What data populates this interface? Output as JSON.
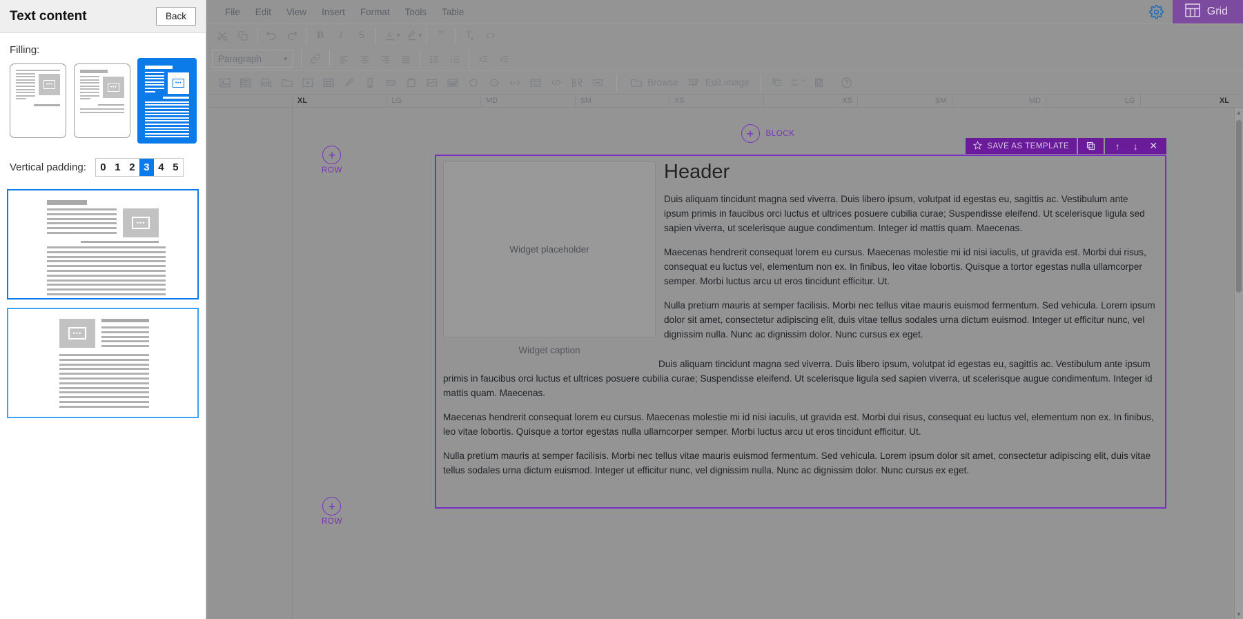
{
  "panel": {
    "title": "Text content",
    "back_label": "Back",
    "filling_label": "Filling:",
    "filling_options": [
      {
        "name": "layout-text-left-image-right",
        "selected": false
      },
      {
        "name": "layout-heading-text-image",
        "selected": false
      },
      {
        "name": "layout-dense-text-image",
        "selected": true
      }
    ],
    "vertical_padding_label": "Vertical padding:",
    "vertical_padding_options": [
      "0",
      "1",
      "2",
      "3",
      "4",
      "5"
    ],
    "vertical_padding_selected": "3",
    "preview_thumbnails": [
      {
        "name": "preview-variant-1",
        "selected": true
      },
      {
        "name": "preview-variant-2",
        "selected": true
      }
    ]
  },
  "menubar": {
    "items": [
      "File",
      "Edit",
      "View",
      "Insert",
      "Format",
      "Tools",
      "Table"
    ],
    "gear_icon": "gear-icon",
    "grid_label": "Grid",
    "grid_icon": "grid-icon"
  },
  "toolbar_row1": [
    {
      "icon": "cut-icon"
    },
    {
      "icon": "copy-icon"
    },
    {
      "sep": true
    },
    {
      "icon": "undo-icon"
    },
    {
      "icon": "redo-icon"
    },
    {
      "sep": true
    },
    {
      "icon": "bold-icon",
      "text": "B"
    },
    {
      "icon": "italic-icon",
      "text": "I"
    },
    {
      "icon": "strikethrough-icon",
      "text": "S"
    },
    {
      "sep": true
    },
    {
      "icon": "text-color-icon",
      "text": "A"
    },
    {
      "icon": "chevron-down-icon"
    },
    {
      "icon": "highlight-color-icon"
    },
    {
      "icon": "chevron-down-icon"
    },
    {
      "sep": true
    },
    {
      "icon": "blockquote-icon"
    },
    {
      "sep": true
    },
    {
      "icon": "clear-formatting-icon"
    },
    {
      "icon": "source-code-icon"
    }
  ],
  "toolbar_row2": {
    "format_select_value": "Paragraph",
    "items": [
      {
        "icon": "link-icon"
      },
      {
        "sep": true
      },
      {
        "icon": "align-left-icon"
      },
      {
        "icon": "align-center-icon"
      },
      {
        "icon": "align-right-icon"
      },
      {
        "icon": "align-justify-icon"
      },
      {
        "sep": true
      },
      {
        "icon": "bullet-list-icon"
      },
      {
        "icon": "numbered-list-icon"
      },
      {
        "sep": true
      },
      {
        "icon": "outdent-icon"
      },
      {
        "icon": "indent-icon"
      }
    ]
  },
  "toolbar_row3": {
    "items": [
      {
        "icon": "image-icon"
      },
      {
        "icon": "image-gallery-icon"
      },
      {
        "icon": "image-stack-icon"
      },
      {
        "icon": "folder-icon"
      },
      {
        "icon": "video-icon"
      },
      {
        "icon": "table-icon"
      },
      {
        "icon": "color-picker-icon"
      },
      {
        "icon": "mobile-icon"
      },
      {
        "icon": "button-icon"
      },
      {
        "icon": "clipboard-icon"
      },
      {
        "icon": "chart-icon"
      },
      {
        "icon": "layout-icon"
      },
      {
        "icon": "circle-icon"
      },
      {
        "icon": "number-circle-icon"
      },
      {
        "icon": "html-tag-icon"
      },
      {
        "icon": "embed-icon"
      },
      {
        "icon": "code-icon"
      },
      {
        "icon": "qr-code-icon"
      },
      {
        "icon": "more-icon"
      }
    ],
    "browse_label": "Browse",
    "browse_icon": "folder-open-icon",
    "edit_image_label": "Edit image",
    "edit_image_icon": "edit-image-icon",
    "extra_icons": [
      {
        "icon": "duplicate-icon"
      },
      {
        "icon": "env-mode-icon"
      },
      {
        "icon": "calculator-icon"
      },
      {
        "icon": "help-icon"
      }
    ]
  },
  "ruler": {
    "left_segments": [
      "XL",
      "LG",
      "MD",
      "SM",
      "XS"
    ],
    "right_segments": [
      "XS",
      "SM",
      "MD",
      "LG",
      "XL"
    ],
    "active": "XL"
  },
  "canvas": {
    "block_add_label": "BLOCK",
    "row_add_label": "ROW",
    "plus_symbol": "+",
    "row_toolbar": {
      "save_as_template_label": "SAVE AS TEMPLATE",
      "star_icon": "star-icon",
      "duplicate_icon": "duplicate-icon",
      "move_up_icon": "arrow-up-icon",
      "move_down_icon": "arrow-down-icon",
      "close_icon": "close-icon"
    },
    "widget_placeholder": "Widget placeholder",
    "widget_caption": "Widget caption",
    "heading": "Header",
    "paragraphs": [
      "Duis aliquam tincidunt magna sed viverra. Duis libero ipsum, volutpat id egestas eu, sagittis ac. Vestibulum ante ipsum primis in faucibus orci luctus et ultrices posuere cubilia curae; Suspendisse eleifend. Ut scelerisque ligula sed sapien viverra, ut scelerisque augue condimentum. Integer id mattis quam. Maecenas.",
      "Maecenas hendrerit consequat lorem eu cursus. Maecenas molestie mi id nisi iaculis, ut gravida est. Morbi dui risus, consequat eu luctus vel, elementum non ex. In finibus, leo vitae lobortis. Quisque a tortor egestas nulla ullamcorper semper. Morbi luctus arcu ut eros tincidunt efficitur. Ut.",
      "Nulla pretium mauris at semper facilisis. Morbi nec tellus vitae mauris euismod fermentum. Sed vehicula. Lorem ipsum dolor sit amet, consectetur adipiscing elit, duis vitae tellus sodales urna dictum euismod. Integer ut efficitur nunc, vel dignissim nulla. Nunc ac dignissim dolor. Nunc cursus ex eget."
    ],
    "full_paragraphs": [
      "Duis aliquam tincidunt magna sed viverra. Duis libero ipsum, volutpat id egestas eu, sagittis ac. Vestibulum ante ipsum primis in faucibus orci luctus et ultrices posuere cubilia curae; Suspendisse eleifend. Ut scelerisque ligula sed sapien viverra, ut scelerisque augue condimentum. Integer id mattis quam. Maecenas.",
      "Maecenas hendrerit consequat lorem eu cursus. Maecenas molestie mi id nisi iaculis, ut gravida est. Morbi dui risus, consequat eu luctus vel, elementum non ex. In finibus, leo vitae lobortis. Quisque a tortor egestas nulla ullamcorper semper. Morbi luctus arcu ut eros tincidunt efficitur. Ut.",
      "Nulla pretium mauris at semper facilisis. Morbi nec tellus vitae mauris euismod fermentum. Sed vehicula. Lorem ipsum dolor sit amet, consectetur adipiscing elit, duis vitae tellus sodales urna dictum euismod. Integer ut efficitur nunc, vel dignissim nulla. Nunc ac dignissim dolor. Nunc cursus ex eget."
    ]
  },
  "colors": {
    "accent_blue": "#0b7bea",
    "purple": "#7b2fbe",
    "toolbar_purple": "#6a1b9a",
    "grid_purple": "#7c4a9e",
    "canvas_gray": "#949494"
  }
}
